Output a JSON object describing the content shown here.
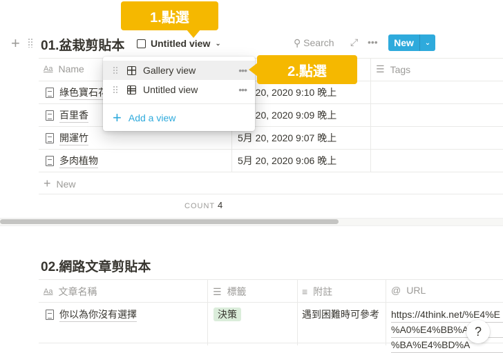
{
  "callouts": [
    "1.點選",
    "2.點選"
  ],
  "db1": {
    "title": "01.盆栽剪貼本",
    "view": "Untitled view",
    "search": "Search",
    "new_label": "New",
    "columns": [
      "Name",
      "Tags"
    ],
    "rows": [
      {
        "name": "綠色寶石花",
        "date": "5月 20, 2020 9:10 晚上"
      },
      {
        "name": "百里香",
        "date": "5月 20, 2020 9:09 晚上"
      },
      {
        "name": "開運竹",
        "date": "5月 20, 2020 9:07 晚上"
      },
      {
        "name": "多肉植物",
        "date": "5月 20, 2020 9:06 晚上"
      }
    ],
    "add_row": "New",
    "count_label": "COUNT",
    "count": "4"
  },
  "menu": {
    "items": [
      "Gallery view",
      "Untitled view"
    ],
    "add": "Add a view"
  },
  "db2": {
    "title": "02.網路文章剪貼本",
    "columns": [
      "文章名稱",
      "標籤",
      "附註",
      "URL"
    ],
    "rows": [
      {
        "name": "你以為你沒有選擇",
        "tag": "決策",
        "note": "遇到困難時可參考",
        "url": [
          "https://4think.net/%E4%E",
          "%A0%E4%BB%A",
          "%BA%E4%BD%A"
        ]
      }
    ]
  },
  "help": "?",
  "colors": {
    "accent": "#2eaadc",
    "callout": "#f5b800",
    "tag": "#dbeddb"
  }
}
